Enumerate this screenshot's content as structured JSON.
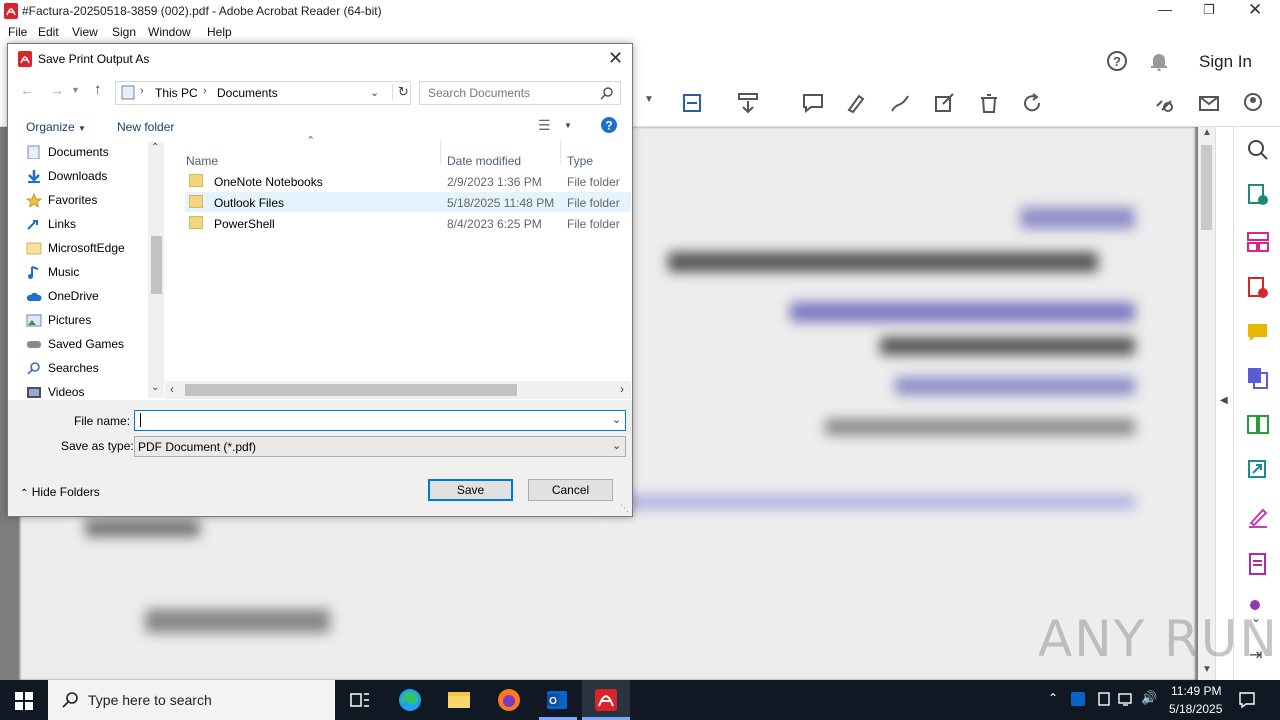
{
  "window": {
    "title": "#Factura-20250518-3859 (002).pdf - Adobe Acrobat Reader (64-bit)",
    "menus": [
      "File",
      "Edit",
      "View",
      "Sign",
      "Window",
      "Help"
    ],
    "sign_in_label": "Sign In"
  },
  "watermark": "ANY RUN",
  "dialog": {
    "title": "Save Print Output As",
    "breadcrumb": [
      "This PC",
      "Documents"
    ],
    "search_placeholder": "Search Documents",
    "organize_label": "Organize",
    "new_folder_label": "New folder",
    "nav_items": [
      {
        "label": "Documents",
        "icon": "documents-icon"
      },
      {
        "label": "Downloads",
        "icon": "downloads-icon"
      },
      {
        "label": "Favorites",
        "icon": "star-icon"
      },
      {
        "label": "Links",
        "icon": "links-icon"
      },
      {
        "label": "MicrosoftEdge",
        "icon": "folder-icon"
      },
      {
        "label": "Music",
        "icon": "music-icon"
      },
      {
        "label": "OneDrive",
        "icon": "cloud-icon"
      },
      {
        "label": "Pictures",
        "icon": "pictures-icon"
      },
      {
        "label": "Saved Games",
        "icon": "games-icon"
      },
      {
        "label": "Searches",
        "icon": "search-icon"
      },
      {
        "label": "Videos",
        "icon": "videos-icon"
      }
    ],
    "columns": {
      "name": "Name",
      "date": "Date modified",
      "type": "Type"
    },
    "files": [
      {
        "name": "OneNote Notebooks",
        "date": "2/9/2023 1:36 PM",
        "type": "File folder"
      },
      {
        "name": "Outlook Files",
        "date": "5/18/2025 11:48 PM",
        "type": "File folder"
      },
      {
        "name": "PowerShell",
        "date": "8/4/2023 6:25 PM",
        "type": "File folder"
      }
    ],
    "file_name_label": "File name:",
    "file_name_value": "",
    "save_type_label": "Save as type:",
    "save_type_value": "PDF Document (*.pdf)",
    "hide_folders_label": "Hide Folders",
    "save_label": "Save",
    "cancel_label": "Cancel"
  },
  "taskbar": {
    "search_placeholder": "Type here to search",
    "time": "11:49 PM",
    "date": "5/18/2025"
  },
  "colors": {
    "accent": "#0078d7",
    "acrobat_red": "#d9252a",
    "taskbar": "#101823"
  }
}
